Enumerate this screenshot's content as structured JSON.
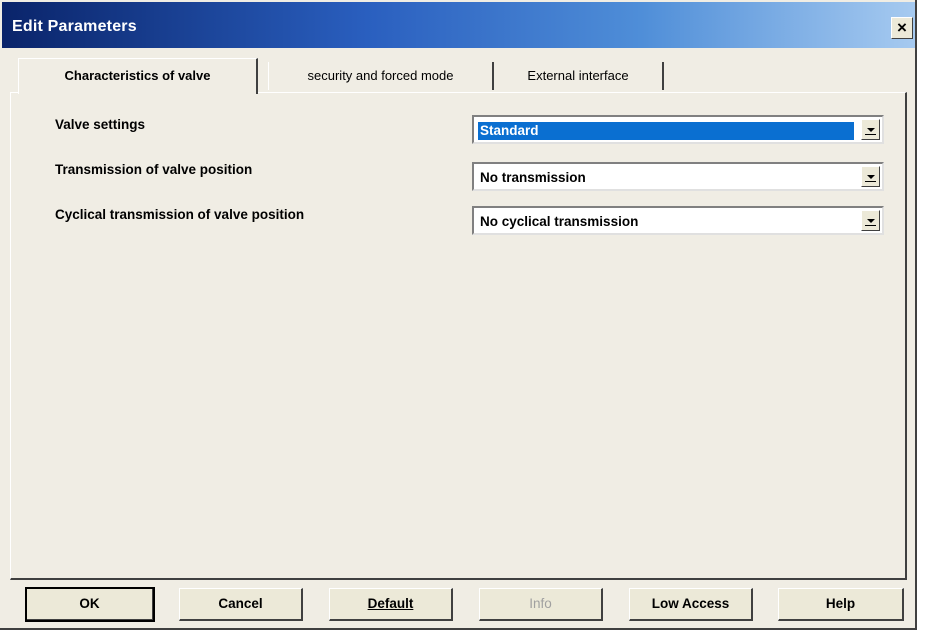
{
  "window": {
    "title": "Edit Parameters",
    "close_glyph": "×"
  },
  "tabs": [
    {
      "label": "Characteristics of valve",
      "active": true
    },
    {
      "label": "security and forced mode",
      "active": false
    },
    {
      "label": "External interface",
      "active": false
    }
  ],
  "parameters": [
    {
      "label": "Valve settings",
      "value": "Standard",
      "focused": true
    },
    {
      "label": "Transmission of valve position",
      "value": "No transmission",
      "focused": false
    },
    {
      "label": "Cyclical transmission of valve position",
      "value": "No cyclical transmission",
      "focused": false
    }
  ],
  "buttons": {
    "ok": "OK",
    "cancel": "Cancel",
    "default": "Default",
    "info": "Info",
    "low_access": "Low Access",
    "help": "Help"
  },
  "colors": {
    "title_bar": "#0a246a",
    "selection": "#0a6fd1",
    "face": "#ece9d8"
  }
}
